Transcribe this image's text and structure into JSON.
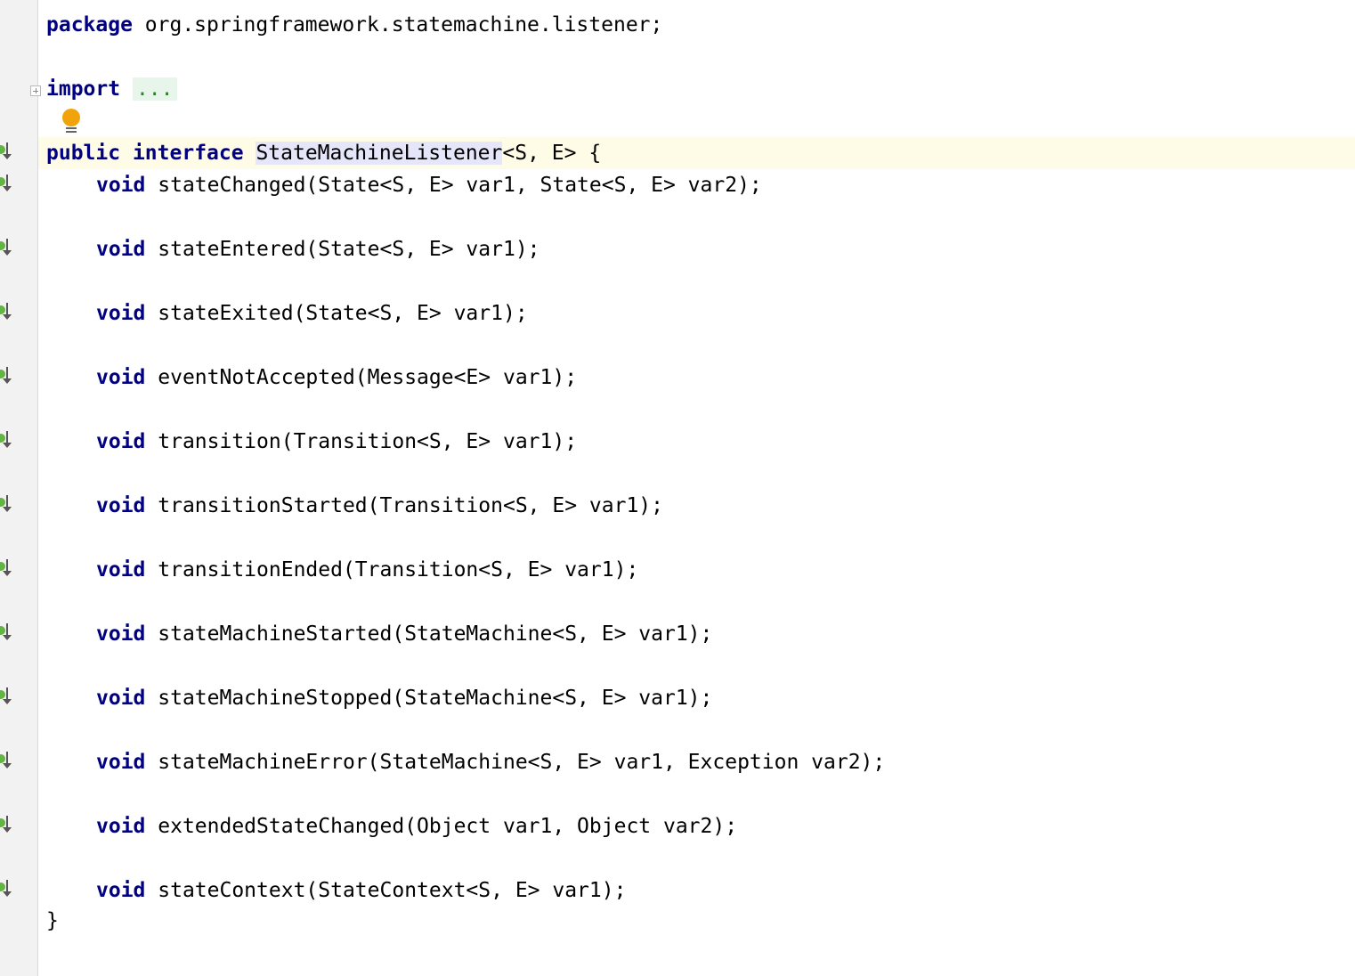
{
  "package_line": {
    "keyword": "package",
    "name": " org.springframework.statemachine.listener;"
  },
  "import_line": {
    "keyword": "import",
    "folded": "..."
  },
  "interface_line": {
    "kw_public": "public",
    "kw_interface": "interface",
    "name": "StateMachineListener",
    "generics": "<S, E> {"
  },
  "methods": [
    {
      "keyword": "void",
      "signature": "stateChanged(State<S, E> var1, State<S, E> var2);"
    },
    {
      "keyword": "void",
      "signature": "stateEntered(State<S, E> var1);"
    },
    {
      "keyword": "void",
      "signature": "stateExited(State<S, E> var1);"
    },
    {
      "keyword": "void",
      "signature": "eventNotAccepted(Message<E> var1);"
    },
    {
      "keyword": "void",
      "signature": "transition(Transition<S, E> var1);"
    },
    {
      "keyword": "void",
      "signature": "transitionStarted(Transition<S, E> var1);"
    },
    {
      "keyword": "void",
      "signature": "transitionEnded(Transition<S, E> var1);"
    },
    {
      "keyword": "void",
      "signature": "stateMachineStarted(StateMachine<S, E> var1);"
    },
    {
      "keyword": "void",
      "signature": "stateMachineStopped(StateMachine<S, E> var1);"
    },
    {
      "keyword": "void",
      "signature": "stateMachineError(StateMachine<S, E> var1, Exception var2);"
    },
    {
      "keyword": "void",
      "signature": "extendedStateChanged(Object var1, Object var2);"
    },
    {
      "keyword": "void",
      "signature": "stateContext(StateContext<S, E> var1);"
    }
  ],
  "closing_brace": "}",
  "icons": {
    "fold": "expand-fold-icon",
    "intention": "lightbulb-icon",
    "implemented": "implemented-method-icon"
  },
  "colors": {
    "keyword": "#000080",
    "caret_line": "#fefbe6",
    "identifier_highlight": "#e6e6fa",
    "folded_region": "#e8f5ea",
    "gutter": "#f2f2f2"
  }
}
